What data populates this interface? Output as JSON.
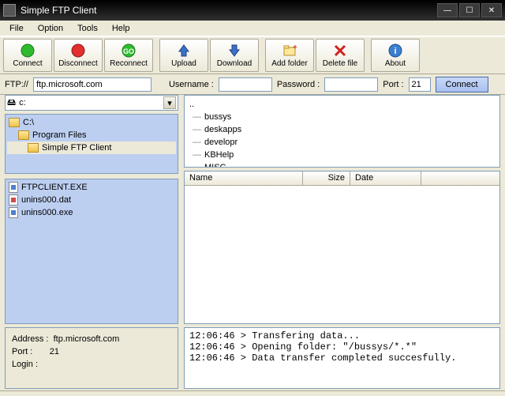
{
  "window": {
    "title": "Simple FTP Client"
  },
  "menu": [
    "File",
    "Option",
    "Tools",
    "Help"
  ],
  "toolbar": [
    {
      "label": "Connect",
      "icon": "green"
    },
    {
      "label": "Disconnect",
      "icon": "red"
    },
    {
      "label": "Reconnect",
      "icon": "go"
    },
    {
      "label": "Upload",
      "icon": "up"
    },
    {
      "label": "Download",
      "icon": "down"
    },
    {
      "label": "Add folder",
      "icon": "folder"
    },
    {
      "label": "Delete file",
      "icon": "x"
    },
    {
      "label": "About",
      "icon": "info"
    }
  ],
  "addr": {
    "ftp_label": "FTP://",
    "host": "ftp.microsoft.com",
    "username_label": "Username :",
    "username": "",
    "password_label": "Password :",
    "password": "",
    "port_label": "Port :",
    "port": "21",
    "connect": "Connect"
  },
  "drive": "c:",
  "local_tree": [
    {
      "label": "C:\\",
      "indent": 0,
      "sel": false
    },
    {
      "label": "Program Files",
      "indent": 1,
      "sel": false
    },
    {
      "label": "Simple FTP Client",
      "indent": 2,
      "sel": true
    }
  ],
  "local_files": [
    {
      "name": "FTPCLIENT.EXE",
      "type": "exe"
    },
    {
      "name": "unins000.dat",
      "type": "dat"
    },
    {
      "name": "unins000.exe",
      "type": "exe"
    }
  ],
  "status": {
    "address_label": "Address :",
    "address": "ftp.microsoft.com",
    "port_label": "Port :",
    "port": "21",
    "login_label": "Login :",
    "login": ""
  },
  "remote_tree": [
    "..",
    "bussys",
    "deskapps",
    "developr",
    "KBHelp",
    "MISC"
  ],
  "columns": {
    "name": "Name",
    "size": "Size",
    "date": "Date"
  },
  "log": [
    "12:06:46 > Transfering data...",
    "12:06:46 > Opening folder: \"/bussys/*.*\"",
    "12:06:46 > Data transfer completed succesfully."
  ]
}
